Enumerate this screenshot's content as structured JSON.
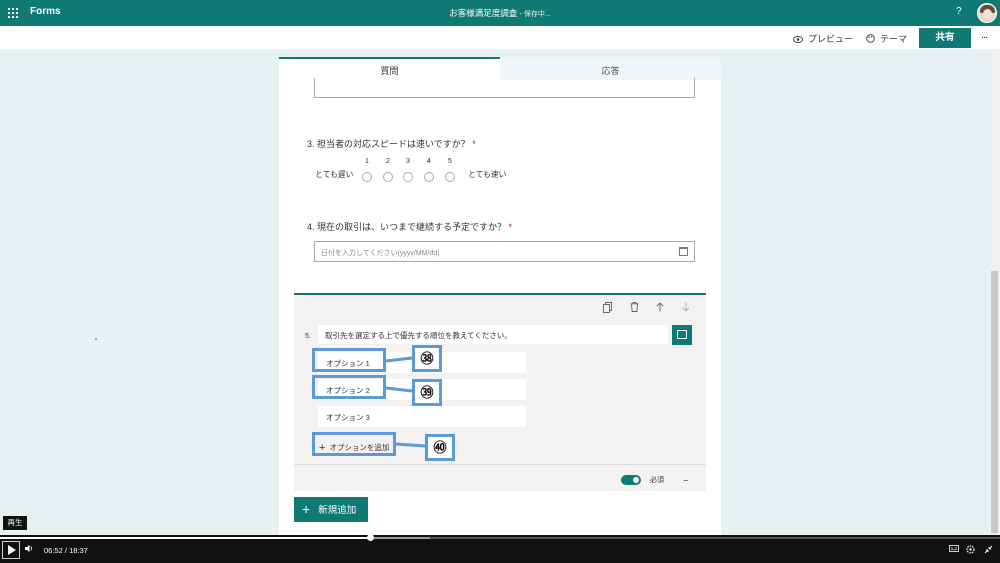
{
  "topbar": {
    "app_name": "Forms",
    "doc_title": "お客様満足度調査",
    "save_status": "- 保存中...",
    "help": "?"
  },
  "commandbar": {
    "preview": "プレビュー",
    "theme": "テーマ",
    "share": "共有",
    "more": "..."
  },
  "tabs": {
    "questions": "質問",
    "responses": "応答"
  },
  "q3": {
    "title": "3. 担当者の対応スピードは速いですか？",
    "required_mark": "*",
    "low_label": "とても遅い",
    "high_label": "とても速い",
    "scale": [
      "1",
      "2",
      "3",
      "4",
      "5"
    ]
  },
  "q4": {
    "title": "4. 現在の取引は、いつまで継続する予定ですか？",
    "required_mark": "*",
    "placeholder": "日付を入力してください(yyyy/MM/dd)"
  },
  "q5": {
    "number": "5.",
    "title": "取引先を選定する上で優先する順位を教えてください。",
    "options": [
      "オプション 1",
      "オプション 2",
      "オプション 3"
    ],
    "add_option": "オプションを追加",
    "required_label": "必須",
    "required_on": true,
    "more": "..."
  },
  "callouts": [
    "㊳",
    "㊴",
    "㊵"
  ],
  "add_new": "新規追加",
  "player": {
    "tooltip": "再生",
    "current_time": "06:52",
    "separator": "/",
    "duration": "18:37",
    "played_fraction": 0.37,
    "loaded_fraction": 0.43
  },
  "colors": {
    "accent": "#0f7a73",
    "callout": "#5b9bd5"
  }
}
